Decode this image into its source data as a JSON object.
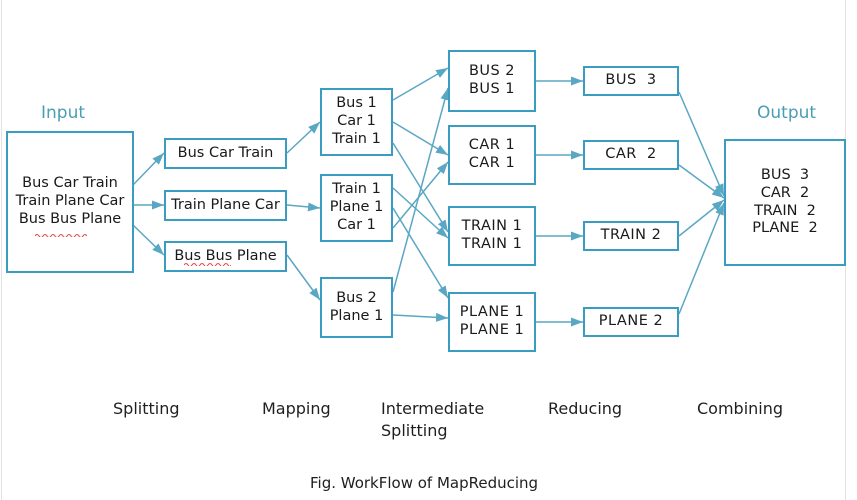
{
  "figure": {
    "caption": "Fig. WorkFlow of MapReducing",
    "accent_color": "#3a9cc0",
    "title_color": "#4a9db5",
    "text_color": "#1a1a1a",
    "background": "#ffffff"
  },
  "columns": {
    "input_title": "Input",
    "output_title": "Output"
  },
  "input": {
    "lines": [
      "Bus Car Train",
      "Train Plane Car",
      "Bus Bus Plane"
    ]
  },
  "splitting": {
    "boxes": [
      {
        "lines": [
          "Bus Car Train"
        ]
      },
      {
        "lines": [
          "Train Plane Car"
        ]
      },
      {
        "lines": [
          "Bus Bus Plane"
        ]
      }
    ]
  },
  "mapping": {
    "boxes": [
      {
        "lines": [
          "Bus 1",
          "Car 1",
          "Train 1"
        ]
      },
      {
        "lines": [
          "Train 1",
          "Plane 1",
          "Car 1"
        ]
      },
      {
        "lines": [
          "Bus 2",
          "Plane 1"
        ]
      }
    ]
  },
  "intermediate_splitting": {
    "boxes": [
      {
        "lines": [
          "BUS 2",
          "BUS 1"
        ]
      },
      {
        "lines": [
          "CAR 1",
          "CAR 1"
        ]
      },
      {
        "lines": [
          "TRAIN 1",
          "TRAIN 1"
        ]
      },
      {
        "lines": [
          "PLANE 1",
          "PLANE 1"
        ]
      }
    ]
  },
  "reducing": {
    "boxes": [
      {
        "lines": [
          "BUS  3"
        ]
      },
      {
        "lines": [
          "CAR  2"
        ]
      },
      {
        "lines": [
          "TRAIN 2"
        ]
      },
      {
        "lines": [
          "PLANE 2"
        ]
      }
    ]
  },
  "output": {
    "lines": [
      "BUS  3",
      "CAR  2",
      "TRAIN  2",
      "PLANE  2"
    ]
  },
  "stage_labels": [
    {
      "text": "Splitting"
    },
    {
      "text": "Mapping"
    },
    {
      "text": "Intermediate\nSplitting"
    },
    {
      "text": "Reducing"
    },
    {
      "text": "Combining"
    }
  ]
}
